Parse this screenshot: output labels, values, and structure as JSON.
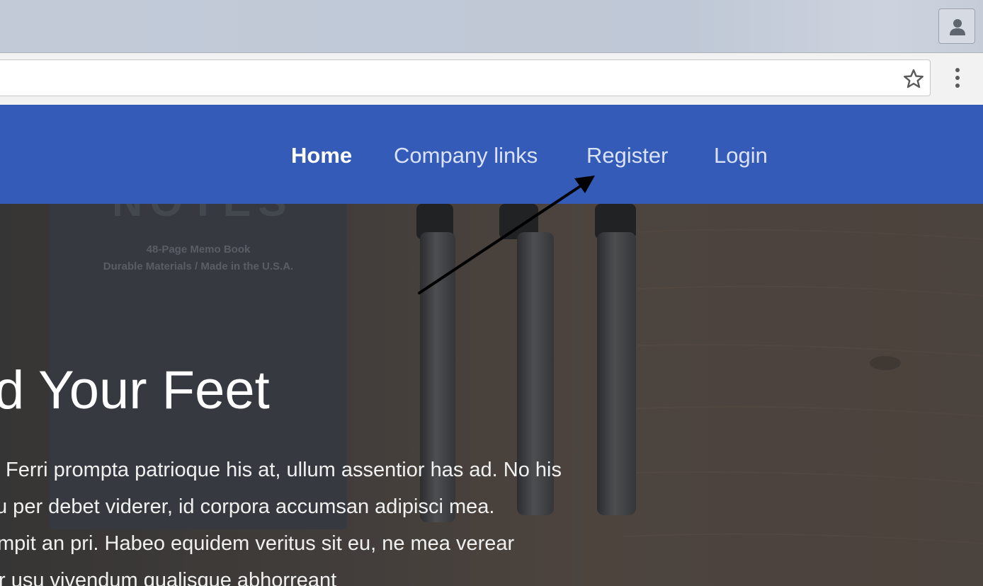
{
  "browser": {
    "profile_icon": "person-icon",
    "bookmark_icon": "star-icon",
    "menu_icon": "vertical-dots-icon",
    "address": ""
  },
  "nav": {
    "items": [
      {
        "label": "Home",
        "active": true
      },
      {
        "label": "Company links",
        "active": false
      },
      {
        "label": "Register",
        "active": false
      },
      {
        "label": "Login",
        "active": false
      }
    ],
    "background": "#345bb7"
  },
  "hero": {
    "notebook_title": "NOTES",
    "notebook_line1": "48-Page Memo Book",
    "notebook_line2": "Durable Materials / Made in the U.S.A.",
    "title": "d Your Feet",
    "paragraph_lines": [
      "Ferri prompta patrioque his at, ullum assentior has ad. No his",
      "u per debet viderer, id corpora accumsan adipisci mea.",
      "mpit an pri. Habeo equidem veritus sit eu, ne mea verear",
      "r usu vivendum qualisque abhorreant"
    ]
  },
  "annotation": {
    "type": "arrow",
    "points_to": "Register"
  }
}
